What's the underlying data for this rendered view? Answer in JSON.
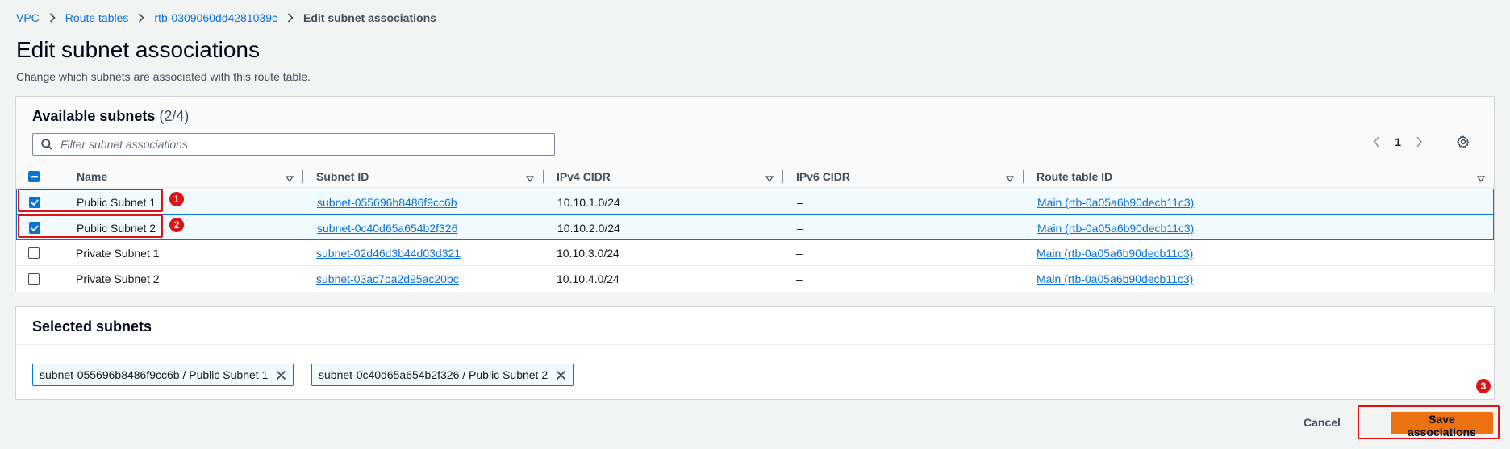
{
  "breadcrumb": {
    "items": [
      "VPC",
      "Route tables",
      "rtb-0309060dd4281039c"
    ],
    "current": "Edit subnet associations"
  },
  "page": {
    "title": "Edit subnet associations",
    "description": "Change which subnets are associated with this route table."
  },
  "available": {
    "title": "Available subnets",
    "count": "(2/4)",
    "filter_placeholder": "Filter subnet associations",
    "page": "1",
    "columns": [
      "Name",
      "Subnet ID",
      "IPv4 CIDR",
      "IPv6 CIDR",
      "Route table ID"
    ],
    "rows": [
      {
        "name": "Public Subnet 1",
        "subnet_id": "subnet-055696b8486f9cc6b",
        "ipv4": "10.10.1.0/24",
        "ipv6": "–",
        "route_table": "Main (rtb-0a05a6b90decb11c3)",
        "checked": true
      },
      {
        "name": "Public Subnet 2",
        "subnet_id": "subnet-0c40d65a654b2f326",
        "ipv4": "10.10.2.0/24",
        "ipv6": "–",
        "route_table": "Main (rtb-0a05a6b90decb11c3)",
        "checked": true
      },
      {
        "name": "Private Subnet 1",
        "subnet_id": "subnet-02d46d3b44d03d321",
        "ipv4": "10.10.3.0/24",
        "ipv6": "–",
        "route_table": "Main (rtb-0a05a6b90decb11c3)",
        "checked": false
      },
      {
        "name": "Private Subnet 2",
        "subnet_id": "subnet-03ac7ba2d95ac20bc",
        "ipv4": "10.10.4.0/24",
        "ipv6": "–",
        "route_table": "Main (rtb-0a05a6b90decb11c3)",
        "checked": false
      }
    ]
  },
  "selected": {
    "title": "Selected subnets",
    "tokens": [
      "subnet-055696b8486f9cc6b / Public Subnet 1",
      "subnet-0c40d65a654b2f326 / Public Subnet 2"
    ]
  },
  "annotations": {
    "markers": [
      "1",
      "2",
      "3"
    ]
  },
  "actions": {
    "cancel": "Cancel",
    "save": "Save associations"
  },
  "colors": {
    "link": "#0972d3",
    "primary_button": "#ec7211",
    "annotation": "#d91515"
  }
}
